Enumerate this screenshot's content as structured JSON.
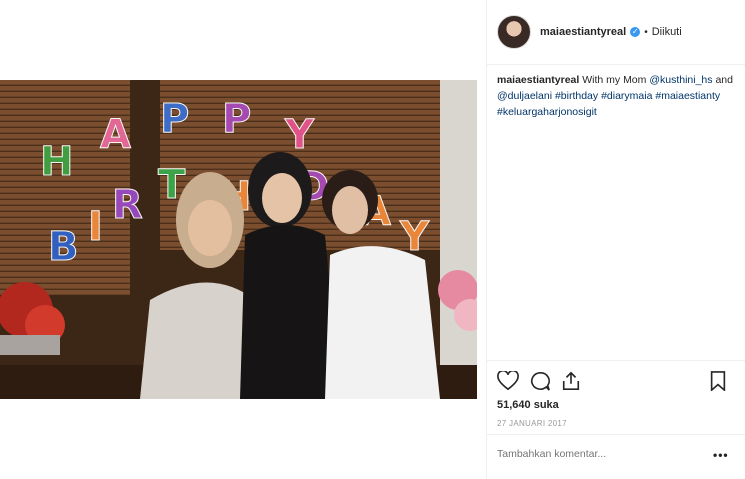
{
  "header": {
    "username": "maiaestiantyreal",
    "separator": "•",
    "follow_status": "Diikuti"
  },
  "caption": {
    "username": "maiaestiantyreal",
    "text_parts": [
      "With my Mom",
      "@kusthini_hs",
      "and",
      "@duljaelani",
      "#birthday",
      "#diarymaia",
      "#maiaestianty",
      "#keluargaharjonosigit"
    ]
  },
  "photo": {
    "balloon_letters": [
      "H",
      "A",
      "P",
      "P",
      "Y",
      "B",
      "I",
      "R",
      "T",
      "H",
      "D",
      "A",
      "Y"
    ]
  },
  "stats": {
    "likes": "51,640 suka",
    "date": "27 JANUARI 2017"
  },
  "comment": {
    "placeholder": "Tambahkan komentar..."
  },
  "icons": [
    "verified-icon",
    "heart-icon",
    "comment-icon",
    "share-icon",
    "bookmark-icon",
    "more-options-icon"
  ],
  "colors": {
    "link": "#003569",
    "verified": "#3897f0",
    "muted": "#999999"
  }
}
